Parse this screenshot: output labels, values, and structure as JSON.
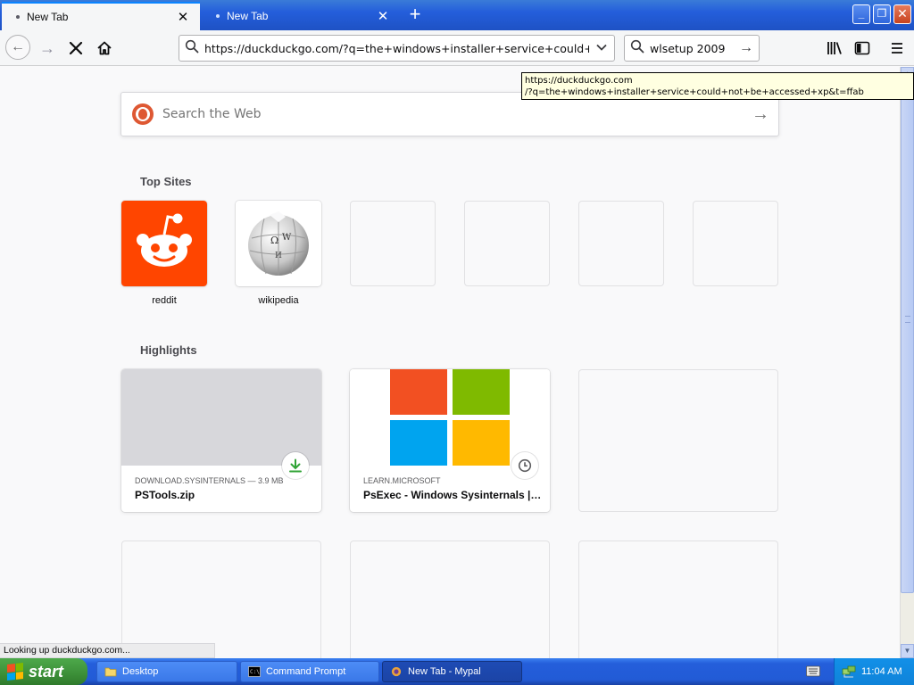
{
  "tabs": [
    {
      "label": "New Tab",
      "active": true
    },
    {
      "label": "New Tab",
      "active": false
    }
  ],
  "window_controls": {
    "minimize": "_",
    "maximize": "❐",
    "close": "✕"
  },
  "nav": {
    "url_value": "https://duckduckgo.com/?q=the+windows+installer+service+could+not+be+accessed+xp&t=ffab",
    "search_value": "wlsetup 2009"
  },
  "tooltip": {
    "line1": "https://duckduckgo.com",
    "line2": "/?q=the+windows+installer+service+could+not+be+accessed+xp&t=ffab"
  },
  "web_search": {
    "placeholder": "Search the Web"
  },
  "top_sites": {
    "title": "Top Sites",
    "items": [
      {
        "label": "reddit"
      },
      {
        "label": "wikipedia"
      }
    ]
  },
  "highlights": {
    "title": "Highlights",
    "items": [
      {
        "context": "DOWNLOAD.SYSINTERNALS — 3.9 MB",
        "title": "PSTools.zip",
        "badge": "download-icon"
      },
      {
        "context": "LEARN.MICROSOFT",
        "title": "PsExec - Windows Sysinternals | Microsoft Learn",
        "badge": "clock-icon"
      }
    ]
  },
  "status": "Looking up duckduckgo.com...",
  "taskbar": {
    "start": "start",
    "items": [
      {
        "label": "Desktop"
      },
      {
        "label": "Command Prompt"
      },
      {
        "label": "New Tab - Mypal"
      }
    ],
    "clock": "11:04 AM"
  },
  "colors": {
    "reddit": "#ff4500",
    "duckduckgo": "#de5833",
    "ms_red": "#f25022",
    "ms_green": "#7fba00",
    "ms_blue": "#00a4ef",
    "ms_yellow": "#ffb900",
    "download_green": "#30a336"
  }
}
